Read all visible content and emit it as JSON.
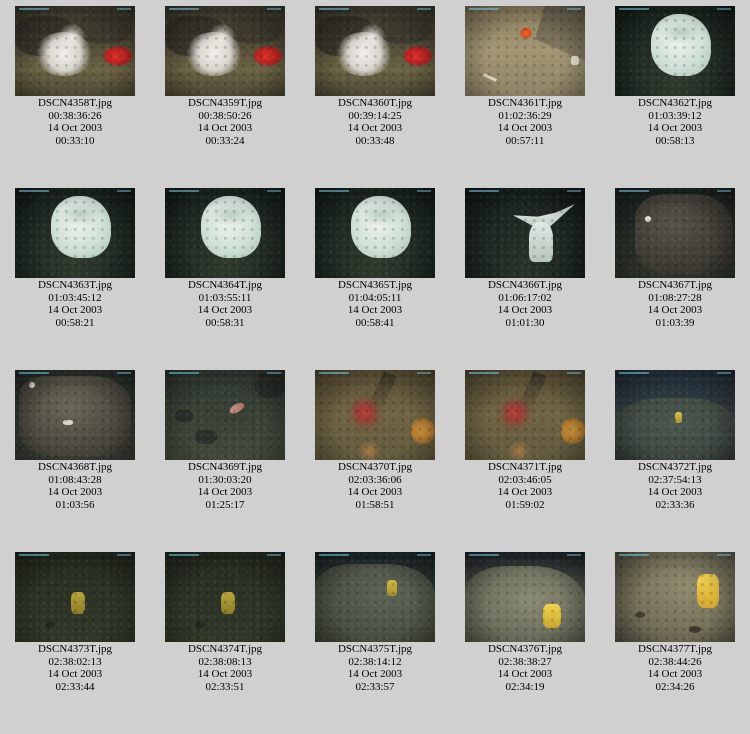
{
  "thumbnails": [
    {
      "filename": "DSCN4358T.jpg",
      "time": "00:38:36:26",
      "date": "14 Oct 2003",
      "elapsed": "00:33:10",
      "scene": "rock-anemone-fluffy"
    },
    {
      "filename": "DSCN4359T.jpg",
      "time": "00:38:50:26",
      "date": "14 Oct 2003",
      "elapsed": "00:33:24",
      "scene": "rock-anemone-fluffy"
    },
    {
      "filename": "DSCN4360T.jpg",
      "time": "00:39:14:25",
      "date": "14 Oct 2003",
      "elapsed": "00:33:48",
      "scene": "rock-anemone-fluffy"
    },
    {
      "filename": "DSCN4361T.jpg",
      "time": "01:02:36:29",
      "date": "14 Oct 2003",
      "elapsed": "00:57:11",
      "scene": "seafloor-starfish"
    },
    {
      "filename": "DSCN4362T.jpg",
      "time": "01:03:39:12",
      "date": "14 Oct 2003",
      "elapsed": "00:58:13",
      "scene": "white-sponge"
    },
    {
      "filename": "DSCN4363T.jpg",
      "time": "01:03:45:12",
      "date": "14 Oct 2003",
      "elapsed": "00:58:21",
      "scene": "white-sponge"
    },
    {
      "filename": "DSCN4364T.jpg",
      "time": "01:03:55:11",
      "date": "14 Oct 2003",
      "elapsed": "00:58:31",
      "scene": "white-sponge"
    },
    {
      "filename": "DSCN4365T.jpg",
      "time": "01:04:05:11",
      "date": "14 Oct 2003",
      "elapsed": "00:58:41",
      "scene": "white-sponge"
    },
    {
      "filename": "DSCN4366T.jpg",
      "time": "01:06:17:02",
      "date": "14 Oct 2003",
      "elapsed": "01:01:30",
      "scene": "white-sponge-open"
    },
    {
      "filename": "DSCN4367T.jpg",
      "time": "01:08:27:28",
      "date": "14 Oct 2003",
      "elapsed": "01:03:39",
      "scene": "dark-boulder"
    },
    {
      "filename": "DSCN4368T.jpg",
      "time": "01:08:43:28",
      "date": "14 Oct 2003",
      "elapsed": "01:03:56",
      "scene": "dark-boulder-close"
    },
    {
      "filename": "DSCN4369T.jpg",
      "time": "01:30:03:20",
      "date": "14 Oct 2003",
      "elapsed": "01:25:17",
      "scene": "rocky-fish"
    },
    {
      "filename": "DSCN4370T.jpg",
      "time": "02:03:36:06",
      "date": "14 Oct 2003",
      "elapsed": "01:58:51",
      "scene": "sand-urchin"
    },
    {
      "filename": "DSCN4371T.jpg",
      "time": "02:03:46:05",
      "date": "14 Oct 2003",
      "elapsed": "01:59:02",
      "scene": "sand-urchin"
    },
    {
      "filename": "DSCN4372T.jpg",
      "time": "02:37:54:13",
      "date": "14 Oct 2003",
      "elapsed": "02:33:36",
      "scene": "plain-yellow-small"
    },
    {
      "filename": "DSCN4373T.jpg",
      "time": "02:38:02:13",
      "date": "14 Oct 2003",
      "elapsed": "02:33:44",
      "scene": "dark-yellow-sponge"
    },
    {
      "filename": "DSCN4374T.jpg",
      "time": "02:38:08:13",
      "date": "14 Oct 2003",
      "elapsed": "02:33:51",
      "scene": "dark-yellow-sponge"
    },
    {
      "filename": "DSCN4375T.jpg",
      "time": "02:38:14:12",
      "date": "14 Oct 2003",
      "elapsed": "02:33:57",
      "scene": "plain-yellow-mid"
    },
    {
      "filename": "DSCN4376T.jpg",
      "time": "02:38:38:27",
      "date": "14 Oct 2003",
      "elapsed": "02:34:19",
      "scene": "plain-yellow-bright"
    },
    {
      "filename": "DSCN4377T.jpg",
      "time": "02:38:44:26",
      "date": "14 Oct 2003",
      "elapsed": "02:34:26",
      "scene": "plain-yellow-close"
    }
  ]
}
